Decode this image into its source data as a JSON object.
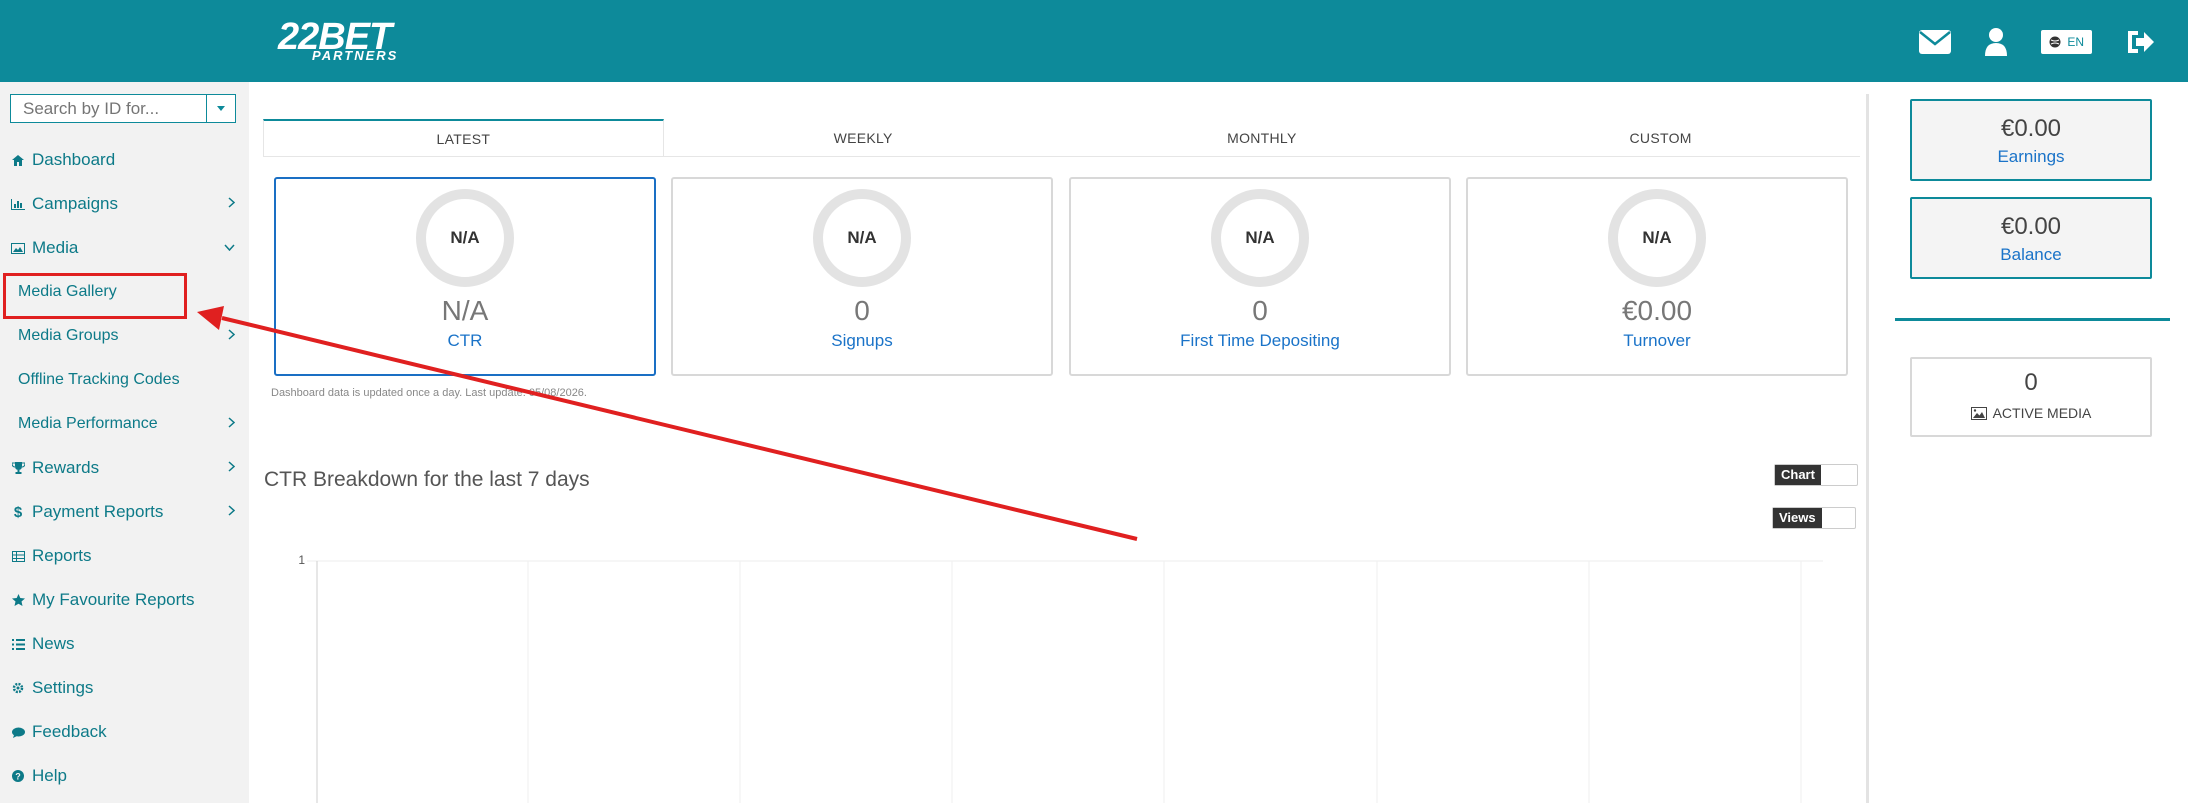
{
  "header": {
    "logo_top": "22BET",
    "logo_bottom": "PARTNERS",
    "language": "EN",
    "brand_color": "#0d8a9a"
  },
  "sidebar": {
    "search_placeholder": "Search by ID for...",
    "items": [
      {
        "label": "Dashboard",
        "icon": "home-icon"
      },
      {
        "label": "Campaigns",
        "icon": "bar-chart-icon"
      },
      {
        "label": "Media",
        "icon": "image-icon"
      },
      {
        "label": "Media Gallery"
      },
      {
        "label": "Media Groups"
      },
      {
        "label": "Offline Tracking Codes"
      },
      {
        "label": "Media Performance"
      },
      {
        "label": "Rewards",
        "icon": "trophy-icon"
      },
      {
        "label": "Payment Reports",
        "icon": "dollar-icon"
      },
      {
        "label": "Reports",
        "icon": "table-icon"
      },
      {
        "label": "My Favourite Reports",
        "icon": "star-icon"
      },
      {
        "label": "News",
        "icon": "list-icon"
      },
      {
        "label": "Settings",
        "icon": "gear-icon"
      },
      {
        "label": "Feedback",
        "icon": "comment-icon"
      },
      {
        "label": "Help",
        "icon": "help-icon"
      }
    ]
  },
  "tabs": [
    "LATEST",
    "WEEKLY",
    "MONTHLY",
    "CUSTOM"
  ],
  "cards": [
    {
      "ring": "N/A",
      "value": "N/A",
      "label": "CTR"
    },
    {
      "ring": "N/A",
      "value": "0",
      "label": "Signups"
    },
    {
      "ring": "N/A",
      "value": "0",
      "label": "First Time Depositing"
    },
    {
      "ring": "N/A",
      "value": "€0.00",
      "label": "Turnover"
    }
  ],
  "note": "Dashboard data is updated once a day. Last update: 05/08/2026.",
  "chart": {
    "title": "CTR Breakdown for the last 7 days",
    "toggle_chart": "Chart",
    "toggle_views": "Views",
    "y_tick": "1"
  },
  "right": {
    "earnings_amount": "€0.00",
    "earnings_label": "Earnings",
    "balance_amount": "€0.00",
    "balance_label": "Balance",
    "active_media_count": "0",
    "active_media_label": "ACTIVE MEDIA"
  }
}
